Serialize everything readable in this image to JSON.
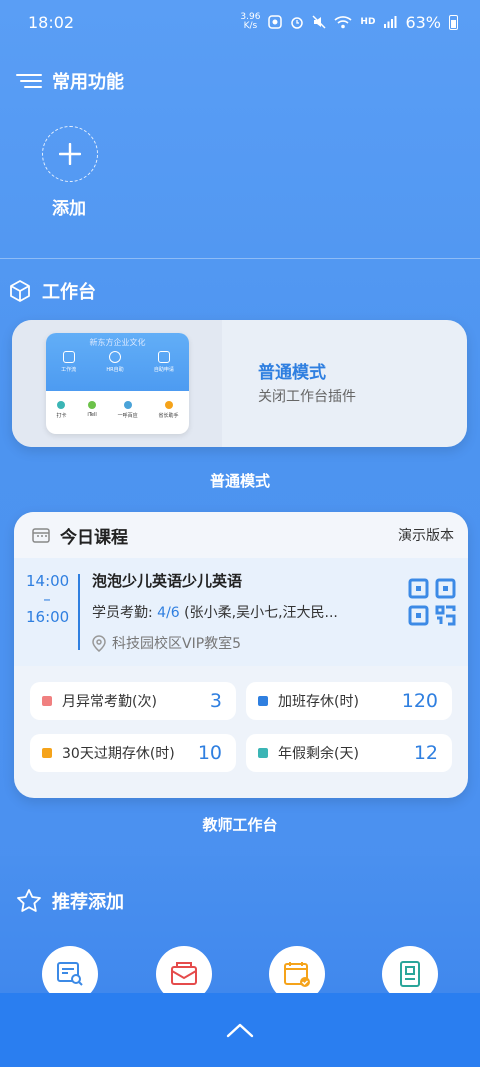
{
  "status_bar": {
    "time": "18:02",
    "net_speed_value": "3.96",
    "net_speed_unit": "K/s",
    "hd_label": "HD",
    "battery": "63%"
  },
  "common": {
    "title": "常用功能",
    "add_label": "添加"
  },
  "workbench": {
    "title": "工作台",
    "mini_preview": {
      "company": "新东方企业文化",
      "top_items": [
        "工作流",
        "HR自助",
        "自助申请"
      ],
      "bottom_items": [
        "打卡",
        "iTell",
        "一呼百应",
        "省长助手"
      ]
    },
    "mode_card": {
      "title": "普通模式",
      "description": "关闭工作台插件"
    },
    "mode_caption": "普通模式"
  },
  "teacher": {
    "header_title": "今日课程",
    "demo_label": "演示版本",
    "time_start": "14:00",
    "time_sep": "–",
    "time_end": "16:00",
    "course_name": "泡泡少儿英语少儿英语",
    "attendance_label": "学员考勤: ",
    "attendance_count": "4/6",
    "attendance_names": " (张小柔,吴小七,汪大民...",
    "location": "科技园校区VIP教室5",
    "stats": [
      {
        "label": "月异常考勤(次)",
        "value": "3",
        "color": "#f08080"
      },
      {
        "label": "加班存休(时)",
        "value": "120",
        "color": "#2f7fe0"
      },
      {
        "label": "30天过期存休(时)",
        "value": "10",
        "color": "#f5a31a"
      },
      {
        "label": "年假剩余(天)",
        "value": "12",
        "color": "#3bb5b5"
      }
    ],
    "caption": "教师工作台"
  },
  "recommend": {
    "title": "推荐添加",
    "icons": [
      "search-report-icon",
      "mail-icon",
      "calendar-check-icon",
      "document-id-icon"
    ]
  },
  "colors": {
    "accent": "#2f7fe0",
    "background": "#4d94f0"
  }
}
